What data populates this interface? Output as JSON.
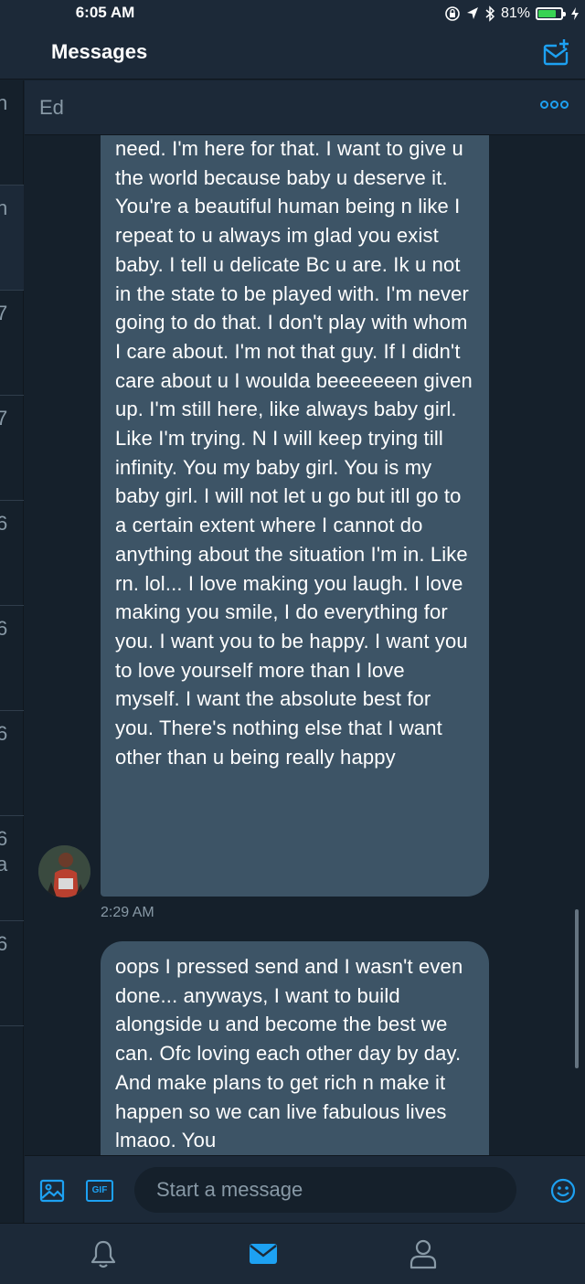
{
  "status_bar": {
    "time": "6:05 AM",
    "battery_text": "81%",
    "battery_level": 0.81,
    "battery_color": "#39d353",
    "indicators": [
      "screen-lock-icon",
      "location-arrow-icon",
      "bluetooth-icon",
      "charging-icon"
    ]
  },
  "header": {
    "title": "Messages",
    "compose_icon": "compose-message-icon"
  },
  "left_list": {
    "row_letters": [
      "n",
      "n",
      "7",
      "7",
      "6",
      "6",
      "6",
      "6",
      "6"
    ],
    "extra_letter": "a"
  },
  "conversation": {
    "name": "Ed",
    "more_icon": "more-options-icon",
    "messages": [
      {
        "text": "need. I'm here for that. I want to give u the world because baby u deserve it. You're a beautiful human being n like I repeat to u always im glad you exist baby. I tell u delicate Bc u are. Ik u not in the state to be played with. I'm never going to do that. I don't play with whom I care about. I'm not that guy. If I didn't care about u I woulda beeeeeeen given up. I'm still here, like always baby girl. Like I'm trying. N I will keep trying till infinity. You my baby girl. You is my baby girl. I will not let u go but itll go to a certain extent where I cannot do anything about the situation I'm in. Like rn. lol... I love making you laugh. I love making you smile, I do everything for you. I want you to be happy. I want you to love yourself more than I love myself. I want the absolute best for you. There's nothing else that I want other than u being really happy",
        "time": "2:29 AM"
      },
      {
        "text": "oops I pressed send and I wasn't even done... anyways, I want to build alongside u and become the best we can. Ofc loving each other day by day. And make plans to get rich n make it happen so we can live fabulous lives lmaoo. You"
      }
    ]
  },
  "composer": {
    "placeholder": "Start a message",
    "image_icon": "image-icon",
    "gif_label": "GIF",
    "emoji_icon": "emoji-icon"
  },
  "tab_bar": {
    "tabs": [
      "notifications-bell-icon",
      "messages-envelope-icon",
      "profile-person-icon"
    ],
    "active": "messages-envelope-icon"
  },
  "colors": {
    "background": "#15202b",
    "panel": "#1c2938",
    "bubble": "#3d5466",
    "accent": "#1da1f2",
    "muted_text": "#8899a6"
  }
}
